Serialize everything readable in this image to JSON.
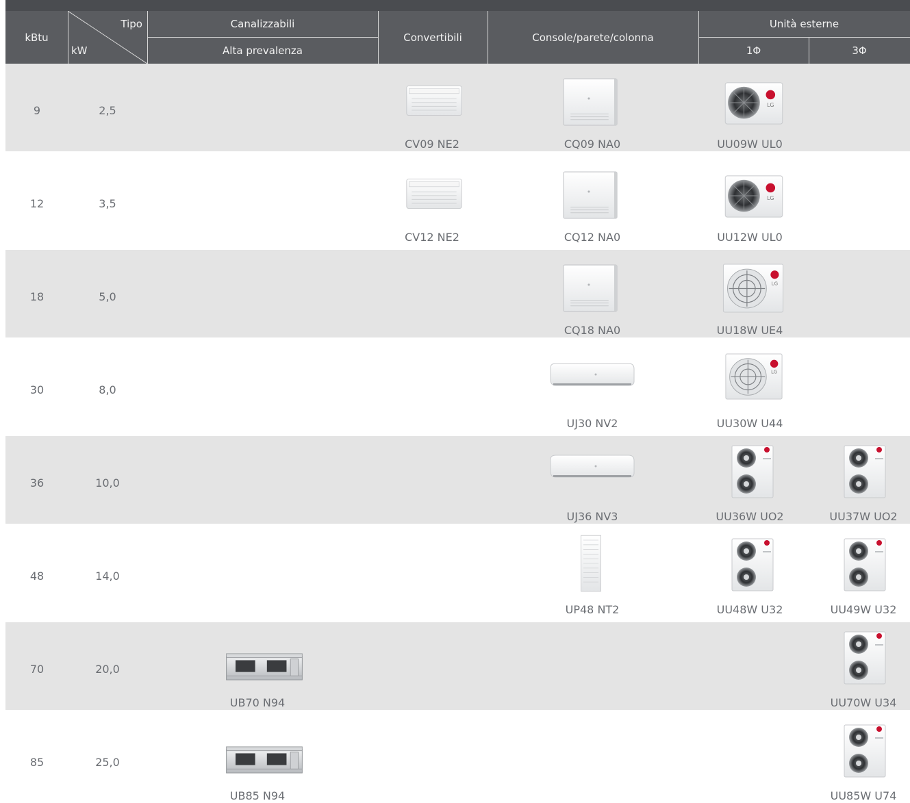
{
  "header": {
    "kbtu": "kBtu",
    "tipo": "Tipo",
    "kw": "kW",
    "canalizzabili": "Canalizzabili",
    "alta_prevalenza": "Alta prevalenza",
    "convertibili": "Convertibili",
    "console": "Console/parete/colonna",
    "unita_esterne": "Unità esterne",
    "single_phase": "1Φ",
    "three_phase": "3Φ"
  },
  "rows": [
    {
      "kbtu": "9",
      "kw": "2,5",
      "canal": "",
      "conv": "CV09 NE2",
      "console": "CQ09 NA0",
      "out1": "UU09W UL0",
      "out3": ""
    },
    {
      "kbtu": "12",
      "kw": "3,5",
      "canal": "",
      "conv": "CV12 NE2",
      "console": "CQ12 NA0",
      "out1": "UU12W UL0",
      "out3": ""
    },
    {
      "kbtu": "18",
      "kw": "5,0",
      "canal": "",
      "conv": "",
      "console": "CQ18 NA0",
      "out1": "UU18W UE4",
      "out3": ""
    },
    {
      "kbtu": "30",
      "kw": "8,0",
      "canal": "",
      "conv": "",
      "console": "UJ30 NV2",
      "out1": "UU30W U44",
      "out3": ""
    },
    {
      "kbtu": "36",
      "kw": "10,0",
      "canal": "",
      "conv": "",
      "console": "UJ36 NV3",
      "out1": "UU36W UO2",
      "out3": "UU37W UO2"
    },
    {
      "kbtu": "48",
      "kw": "14,0",
      "canal": "",
      "conv": "",
      "console": "UP48 NT2",
      "out1": "UU48W U32",
      "out3": "UU49W U32"
    },
    {
      "kbtu": "70",
      "kw": "20,0",
      "canal": "UB70 N94",
      "conv": "",
      "console": "",
      "out1": "",
      "out3": "UU70W U34"
    },
    {
      "kbtu": "85",
      "kw": "25,0",
      "canal": "UB85 N94",
      "conv": "",
      "console": "",
      "out1": "",
      "out3": "UU85W U74"
    }
  ]
}
